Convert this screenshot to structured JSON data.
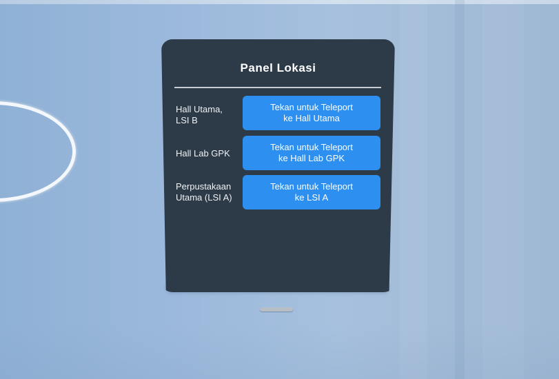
{
  "panel": {
    "title": "Panel Lokasi",
    "rows": [
      {
        "label_line1": "Hall Utama,",
        "label_line2": "LSI B",
        "button_line1": "Tekan untuk Teleport",
        "button_line2": "ke Hall Utama"
      },
      {
        "label_line1": "Hall Lab GPK",
        "label_line2": "",
        "button_line1": "Tekan untuk Teleport",
        "button_line2": "ke Hall Lab GPK"
      },
      {
        "label_line1": "Perpustakaan",
        "label_line2": "Utama (LSI A)",
        "button_line1": "Tekan untuk Teleport",
        "button_line2": "ke LSI A"
      }
    ]
  },
  "colors": {
    "panel_bg": "#2d3a48",
    "button_bg": "#2d8ff0",
    "sky_wall": "#9dbadc",
    "ring": "#f4f7fb"
  },
  "icons": {
    "teleport_marker": "teleport-ring-icon",
    "panel_handle": "grab-handle-icon"
  }
}
